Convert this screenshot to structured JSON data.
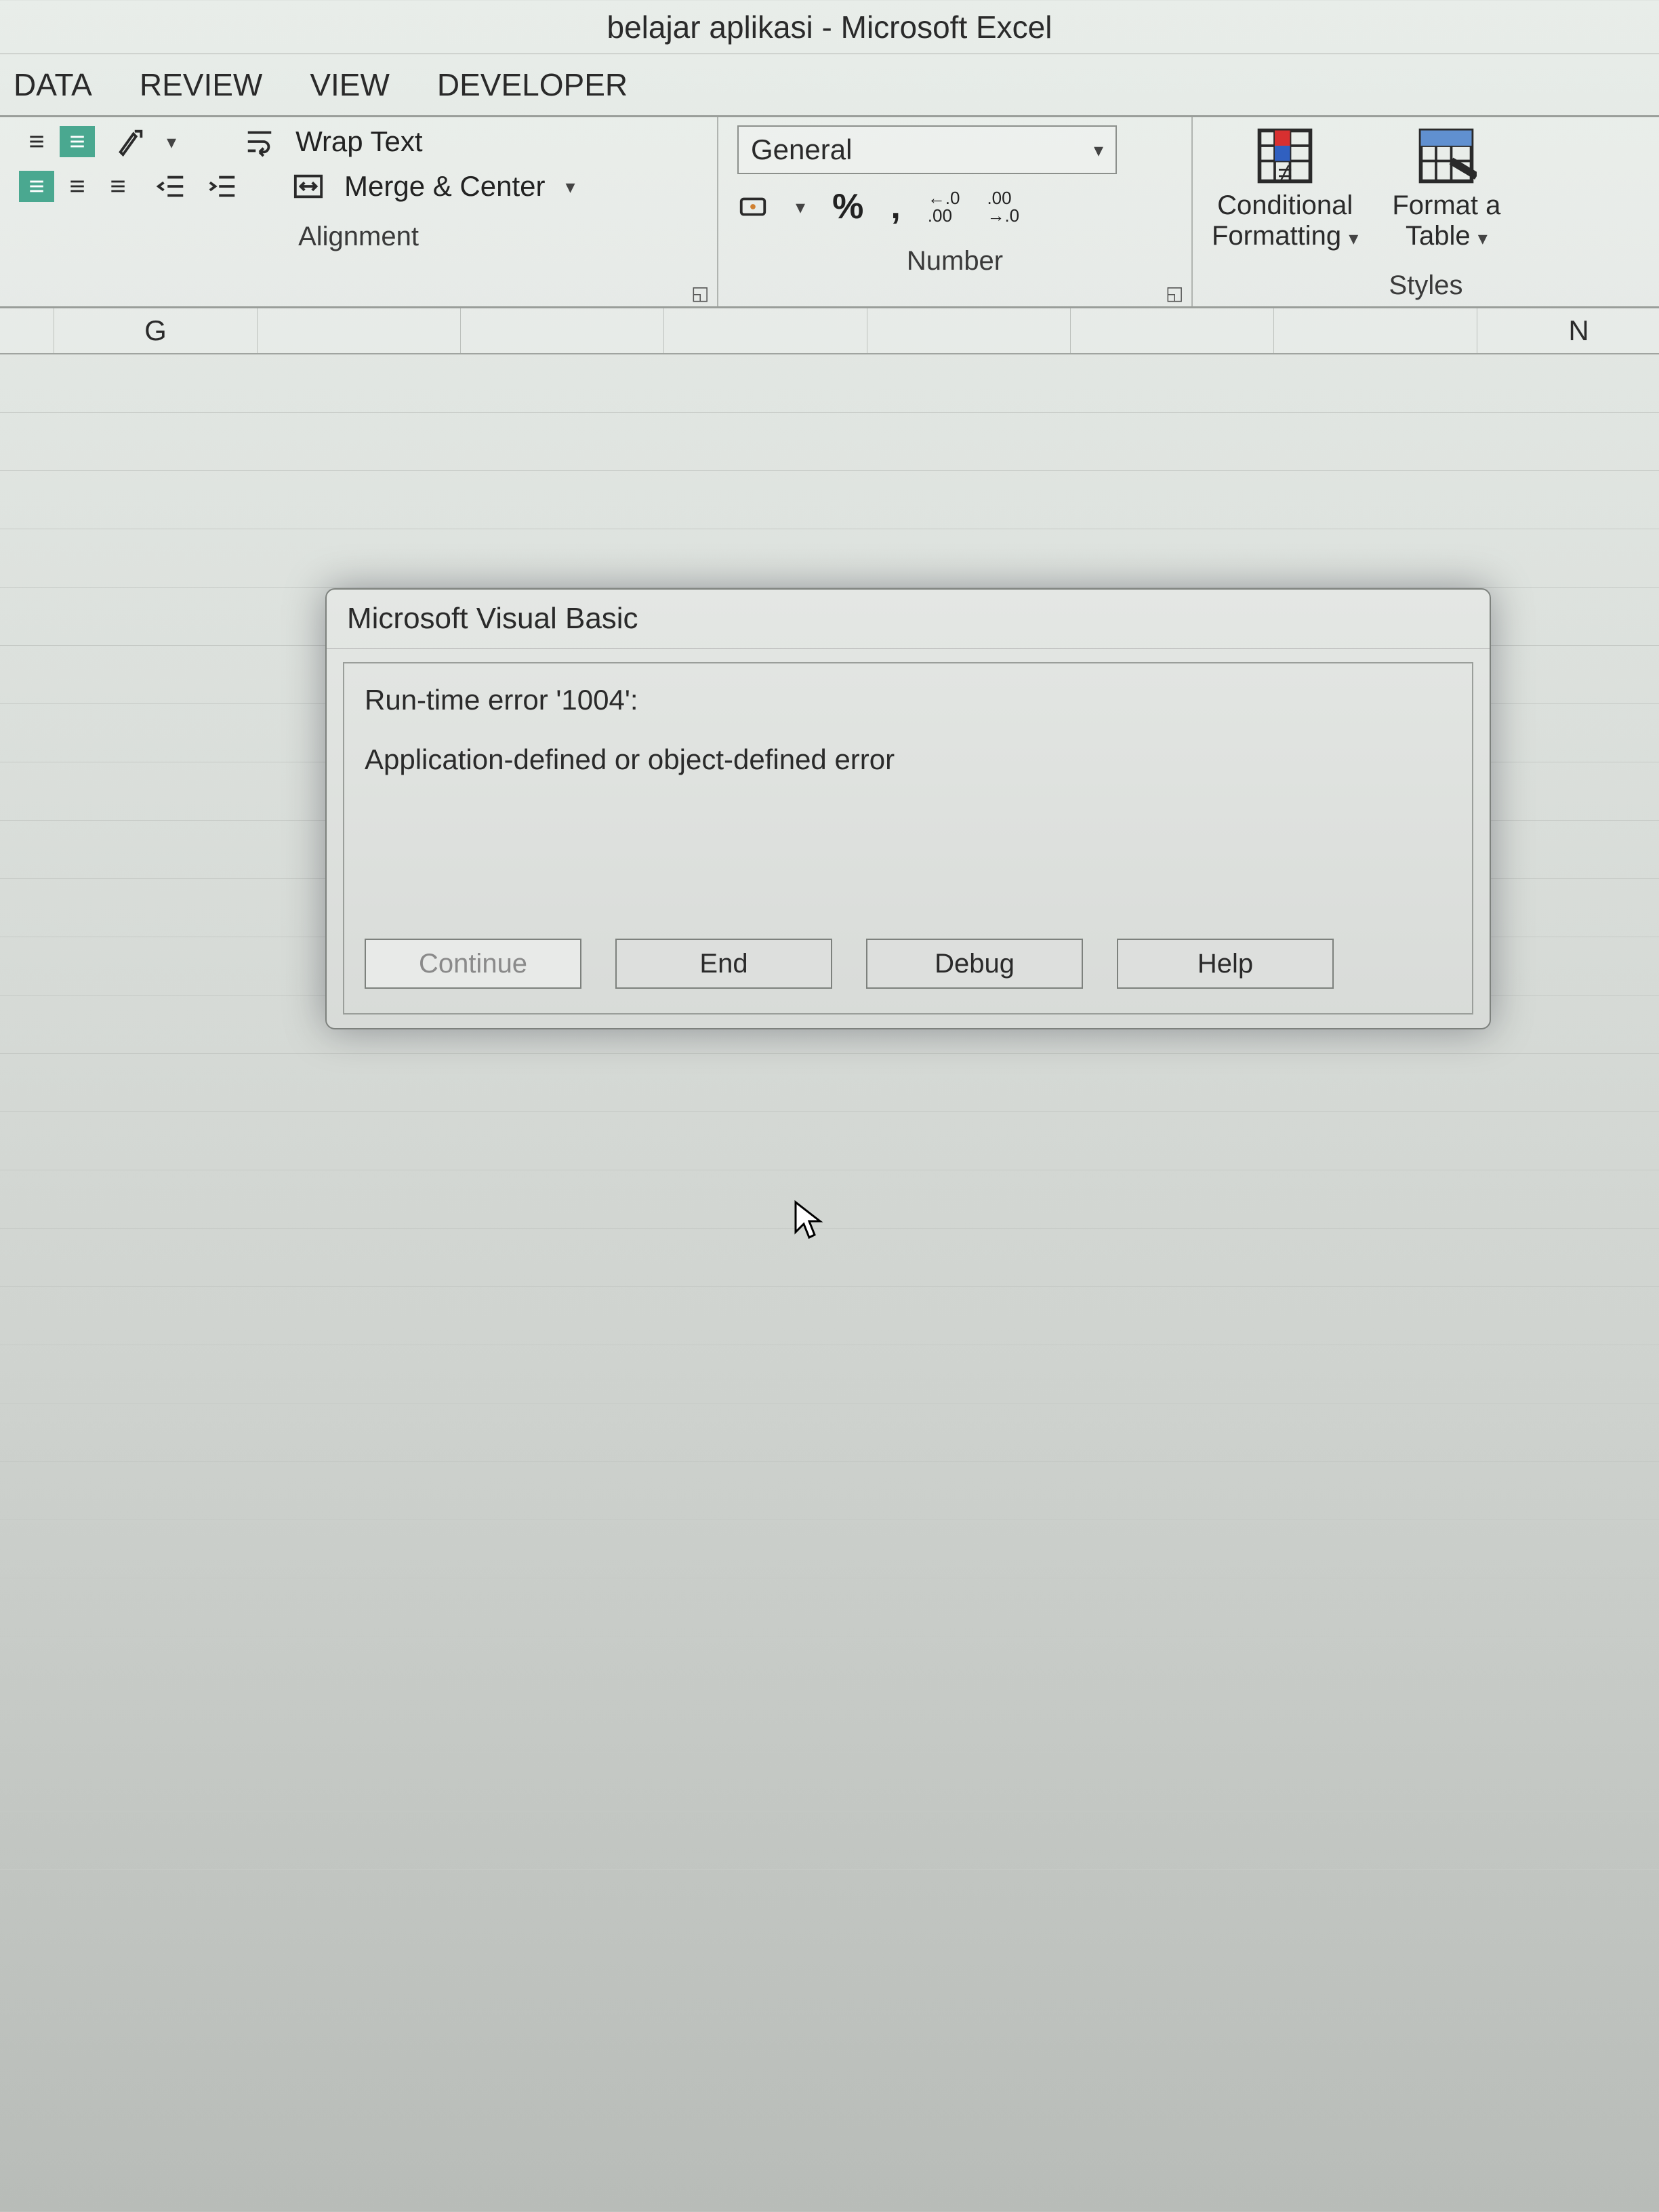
{
  "app_title": "belajar aplikasi - Microsoft Excel",
  "ribbon": {
    "tabs": [
      "DATA",
      "REVIEW",
      "VIEW",
      "DEVELOPER"
    ],
    "alignment": {
      "wrap_text": "Wrap Text",
      "merge_center": "Merge & Center",
      "group_label": "Alignment"
    },
    "number": {
      "format_selected": "General",
      "percent": "%",
      "comma": ",",
      "inc_dec": "←0 .00",
      "dec_inc": ".00 →0",
      "group_label": "Number"
    },
    "styles": {
      "conditional": "Conditional",
      "formatting": "Formatting",
      "format_as": "Format a",
      "table": "Table",
      "group_label": "Styles"
    }
  },
  "sheet": {
    "visible_columns": [
      "G",
      "",
      "",
      "",
      "",
      "",
      "",
      "N"
    ]
  },
  "dialog": {
    "title": "Microsoft Visual Basic",
    "line1": "Run-time error '1004':",
    "line2": "Application-defined or object-defined error",
    "buttons": {
      "continue": "Continue",
      "end": "End",
      "debug": "Debug",
      "help": "Help"
    }
  }
}
